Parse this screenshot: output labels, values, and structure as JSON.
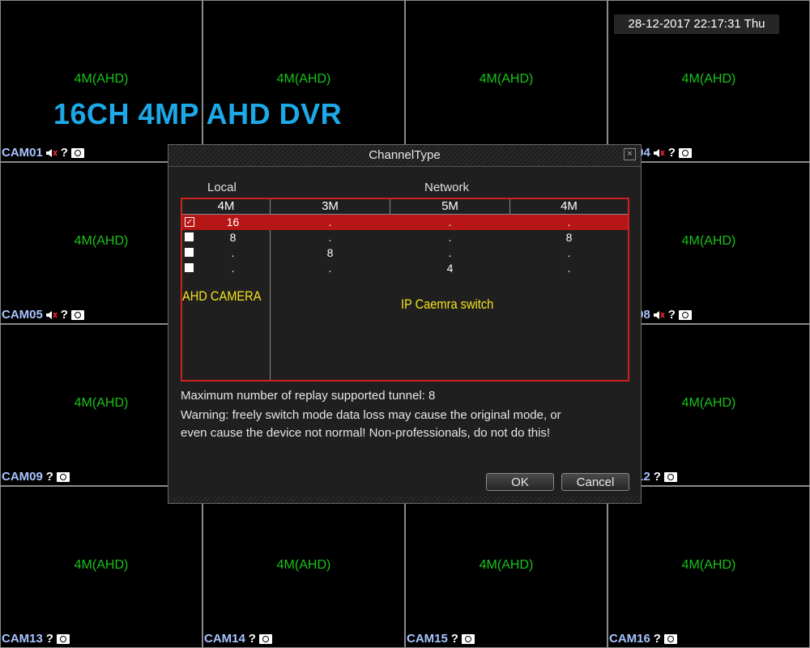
{
  "timestamp": "28-12-2017 22:17:31 Thu",
  "banner": "16CH 4MP AHD DVR",
  "channel_text": "4M(AHD)",
  "cameras": [
    {
      "label": "CAM01",
      "audio": true
    },
    {
      "label": "",
      "audio": false
    },
    {
      "label": "",
      "audio": false
    },
    {
      "label": "CAM04",
      "audio": true
    },
    {
      "label": "CAM05",
      "audio": true
    },
    {
      "label": "",
      "audio": false
    },
    {
      "label": "",
      "audio": false
    },
    {
      "label": "CAM08",
      "audio": true
    },
    {
      "label": "CAM09",
      "audio": false
    },
    {
      "label": "",
      "audio": false
    },
    {
      "label": "",
      "audio": false
    },
    {
      "label": "CAM12",
      "audio": false
    },
    {
      "label": "CAM13",
      "audio": false
    },
    {
      "label": "CAM14",
      "audio": false
    },
    {
      "label": "CAM15",
      "audio": false
    },
    {
      "label": "CAM16",
      "audio": false
    }
  ],
  "dialog": {
    "title": "ChannelType",
    "close_glyph": "×",
    "local_header": "Local",
    "network_header": "Network",
    "columns": [
      "4M",
      "3M",
      "5M",
      "4M"
    ],
    "rows": [
      {
        "checked": true,
        "selected": true,
        "cells": [
          "16",
          ".",
          ".",
          "."
        ]
      },
      {
        "checked": false,
        "selected": false,
        "cells": [
          "8",
          ".",
          ".",
          "8"
        ]
      },
      {
        "checked": false,
        "selected": false,
        "cells": [
          ".",
          "8",
          ".",
          "."
        ]
      },
      {
        "checked": false,
        "selected": false,
        "cells": [
          ".",
          ".",
          "4",
          "."
        ]
      }
    ],
    "ahd_note": "AHD CAMERA",
    "ip_note": "IP Caemra switch",
    "replay_info": "Maximum number of replay supported tunnel: 8",
    "warning_line1": "Warning: freely switch mode data loss may cause the original mode, or",
    "warning_line2": "even cause the device not normal! Non-professionals, do not do this!",
    "ok_label": "OK",
    "cancel_label": "Cancel"
  },
  "colors": {
    "channel_text": "#19c319",
    "cam_label": "#a8c4ff",
    "banner": "#1da9e8",
    "highlight": "#b71616",
    "note": "#f5e21e"
  }
}
